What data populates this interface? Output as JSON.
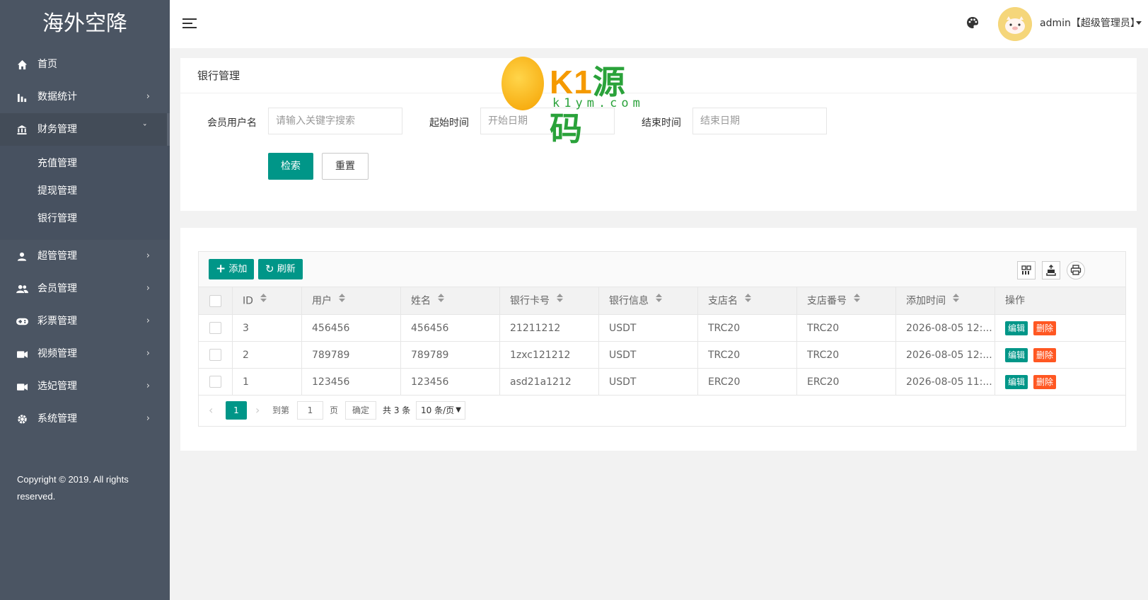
{
  "sidebar": {
    "logo": "海外空降",
    "items": [
      {
        "label": "首页",
        "icon": "home-icon"
      },
      {
        "label": "数据统计",
        "icon": "bar-chart-icon"
      },
      {
        "label": "财务管理",
        "icon": "bank-icon"
      },
      {
        "label": "超管管理",
        "icon": "user-icon"
      },
      {
        "label": "会员管理",
        "icon": "users-icon"
      },
      {
        "label": "彩票管理",
        "icon": "gamepad-icon"
      },
      {
        "label": "视频管理",
        "icon": "video-icon"
      },
      {
        "label": "选妃管理",
        "icon": "video-icon"
      },
      {
        "label": "系统管理",
        "icon": "gear-icon"
      }
    ],
    "finance_sub": [
      "充值管理",
      "提现管理",
      "银行管理"
    ],
    "copyright": "Copyright © 2019. All rights reserved."
  },
  "header": {
    "user": "admin【超级管理员】"
  },
  "watermark": {
    "brand_k": "K1",
    "brand_cn": "源码",
    "sub": "k1ym.com"
  },
  "search": {
    "title": "银行管理",
    "member_label": "会员用户名",
    "member_placeholder": "请输入关键字搜索",
    "start_label": "起始时间",
    "start_placeholder": "开始日期",
    "end_label": "结束时间",
    "end_placeholder": "结束日期",
    "search_btn": "检索",
    "reset_btn": "重置"
  },
  "table": {
    "add_btn": "添加",
    "refresh_btn": "刷新",
    "columns": [
      "ID",
      "用户",
      "姓名",
      "银行卡号",
      "银行信息",
      "支店名",
      "支店番号",
      "添加时间",
      "操作"
    ],
    "rows": [
      {
        "id": "3",
        "user": "456456",
        "name": "456456",
        "card": "21211212",
        "bank": "USDT",
        "branch": "TRC20",
        "branch_no": "TRC20",
        "time": "2026-08-05 12:..."
      },
      {
        "id": "2",
        "user": "789789",
        "name": "789789",
        "card": "1zxc121212",
        "bank": "USDT",
        "branch": "TRC20",
        "branch_no": "TRC20",
        "time": "2026-08-05 12:..."
      },
      {
        "id": "1",
        "user": "123456",
        "name": "123456",
        "card": "asd21a1212",
        "bank": "USDT",
        "branch": "ERC20",
        "branch_no": "ERC20",
        "time": "2026-08-05 11:..."
      }
    ],
    "edit_label": "编辑",
    "delete_label": "删除"
  },
  "pager": {
    "current": "1",
    "goto_label": "到第",
    "goto_value": "1",
    "page_unit": "页",
    "confirm": "确定",
    "total": "共 3 条",
    "page_size": "10 条/页"
  },
  "colors": {
    "sidebar_bg": "#4b5563",
    "primary": "#009688",
    "danger": "#ff5722"
  }
}
